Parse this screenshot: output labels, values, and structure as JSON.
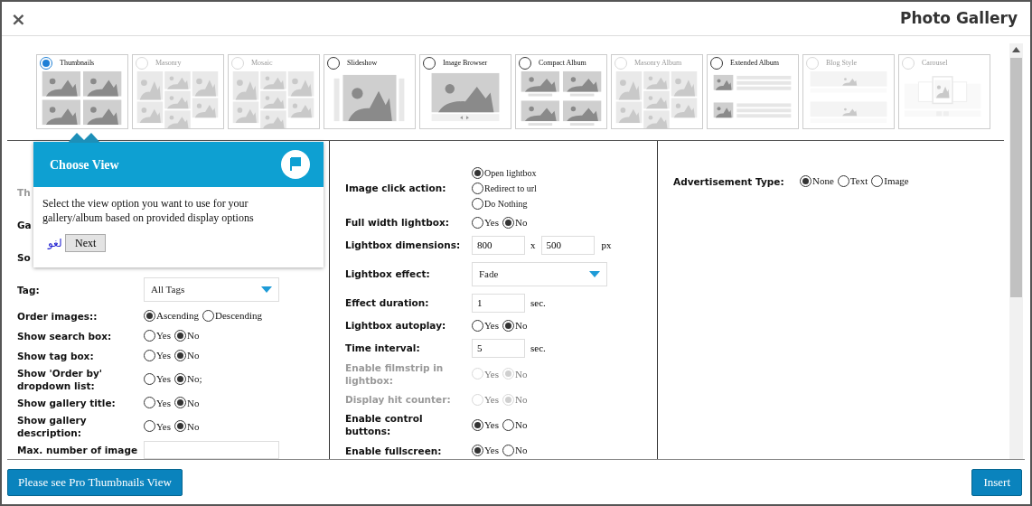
{
  "window": {
    "title": "Photo Gallery",
    "close": "×"
  },
  "views": [
    {
      "label": "Thumbnails",
      "selected": true,
      "disabled": false,
      "kind": "grid"
    },
    {
      "label": "Masonry",
      "selected": false,
      "disabled": true,
      "kind": "masonry"
    },
    {
      "label": "Mosaic",
      "selected": false,
      "disabled": true,
      "kind": "masonry"
    },
    {
      "label": "Slideshow",
      "selected": false,
      "disabled": false,
      "kind": "slideshow"
    },
    {
      "label": "Image Browser",
      "selected": false,
      "disabled": false,
      "kind": "browser"
    },
    {
      "label": "Compact Album",
      "selected": false,
      "disabled": false,
      "kind": "compact"
    },
    {
      "label": "Masonry Album",
      "selected": false,
      "disabled": true,
      "kind": "masonry"
    },
    {
      "label": "Extended Album",
      "selected": false,
      "disabled": false,
      "kind": "extended"
    },
    {
      "label": "Blog Style",
      "selected": false,
      "disabled": true,
      "kind": "blog"
    },
    {
      "label": "Carousel",
      "selected": false,
      "disabled": true,
      "kind": "carousel"
    }
  ],
  "tour": {
    "title": "Choose View",
    "text": "Select the view option you want to use for your gallery/album based on provided display options",
    "skip": "لغو",
    "next": "Next"
  },
  "columns": [
    {
      "rows": [
        {
          "label": "Th",
          "kind": "text",
          "disabled": true
        },
        {
          "label": "Ga",
          "kind": "text",
          "disabled": false
        },
        {
          "label": "So",
          "kind": "text",
          "disabled": false
        },
        {
          "label": "Tag:",
          "kind": "select",
          "disabled": false,
          "value": "All Tags"
        },
        {
          "label": "Order images::",
          "kind": "radio",
          "disabled": false,
          "options": [
            {
              "label": "Ascending",
              "selected": true
            },
            {
              "label": "Descending",
              "selected": false
            }
          ]
        },
        {
          "label": "Show search box:",
          "kind": "radio",
          "disabled": false,
          "options": [
            {
              "label": "Yes",
              "selected": false
            },
            {
              "label": "No",
              "selected": true
            }
          ]
        },
        {
          "label": "Show tag box:",
          "kind": "radio",
          "disabled": false,
          "options": [
            {
              "label": "Yes",
              "selected": false
            },
            {
              "label": "No",
              "selected": true
            }
          ]
        },
        {
          "label": "Show 'Order by' dropdown list:",
          "kind": "radio",
          "disabled": false,
          "options": [
            {
              "label": "Yes",
              "selected": false
            },
            {
              "label": "No;",
              "selected": true
            }
          ]
        },
        {
          "label": "Show gallery title:",
          "kind": "radio",
          "disabled": false,
          "options": [
            {
              "label": "Yes",
              "selected": false
            },
            {
              "label": "No",
              "selected": true
            }
          ]
        },
        {
          "label": "Show gallery description:",
          "kind": "radio",
          "disabled": false,
          "options": [
            {
              "label": "Yes",
              "selected": false
            },
            {
              "label": "No",
              "selected": true
            }
          ]
        },
        {
          "label": "Max. number of image",
          "kind": "field",
          "disabled": false
        }
      ]
    },
    {
      "rows": [
        {
          "label": "Image click action:",
          "kind": "stack",
          "disabled": false,
          "options": [
            {
              "label": "Open lightbox",
              "selected": true
            },
            {
              "label": "Redirect to url",
              "selected": false
            },
            {
              "label": "Do Nothing",
              "selected": false
            }
          ]
        },
        {
          "label": "Full width lightbox:",
          "kind": "radio",
          "disabled": false,
          "options": [
            {
              "label": "Yes",
              "selected": false
            },
            {
              "label": "No",
              "selected": true
            }
          ]
        },
        {
          "label": "Lightbox dimensions:",
          "kind": "dimensions",
          "disabled": false,
          "values": [
            "800",
            "500"
          ],
          "separator": "x",
          "unit": "px"
        },
        {
          "label": "Lightbox effect:",
          "kind": "select",
          "disabled": false,
          "value": "Fade"
        },
        {
          "label": "Effect duration:",
          "kind": "input",
          "disabled": false,
          "value": "1",
          "unit": "sec."
        },
        {
          "label": "Lightbox autoplay:",
          "kind": "radio",
          "disabled": false,
          "options": [
            {
              "label": "Yes",
              "selected": false
            },
            {
              "label": "No",
              "selected": true
            }
          ]
        },
        {
          "label": "Time interval:",
          "kind": "input",
          "disabled": false,
          "value": "5",
          "unit": "sec."
        },
        {
          "label": "Enable filmstrip in lightbox:",
          "kind": "radio",
          "disabled": true,
          "options": [
            {
              "label": "Yes",
              "selected": false
            },
            {
              "label": "No",
              "selected": true
            }
          ]
        },
        {
          "label": "Display hit counter:",
          "kind": "radio",
          "disabled": true,
          "options": [
            {
              "label": "Yes",
              "selected": false
            },
            {
              "label": "No",
              "selected": true
            }
          ]
        },
        {
          "label": "Enable control buttons:",
          "kind": "radio",
          "disabled": false,
          "options": [
            {
              "label": "Yes",
              "selected": true
            },
            {
              "label": "No",
              "selected": false
            }
          ]
        },
        {
          "label": "Enable fullscreen:",
          "kind": "radio",
          "disabled": false,
          "options": [
            {
              "label": "Yes",
              "selected": true
            },
            {
              "label": "No",
              "selected": false
            }
          ]
        }
      ]
    },
    {
      "rows": [
        {
          "label": "Advertisement Type:",
          "kind": "radio",
          "disabled": false,
          "options": [
            {
              "label": "None",
              "selected": true
            },
            {
              "label": "Text",
              "selected": false
            },
            {
              "label": "Image",
              "selected": false
            }
          ]
        }
      ]
    }
  ],
  "footer": {
    "pro_button": "Please see Pro Thumbnails View",
    "insert_button": "Insert"
  }
}
